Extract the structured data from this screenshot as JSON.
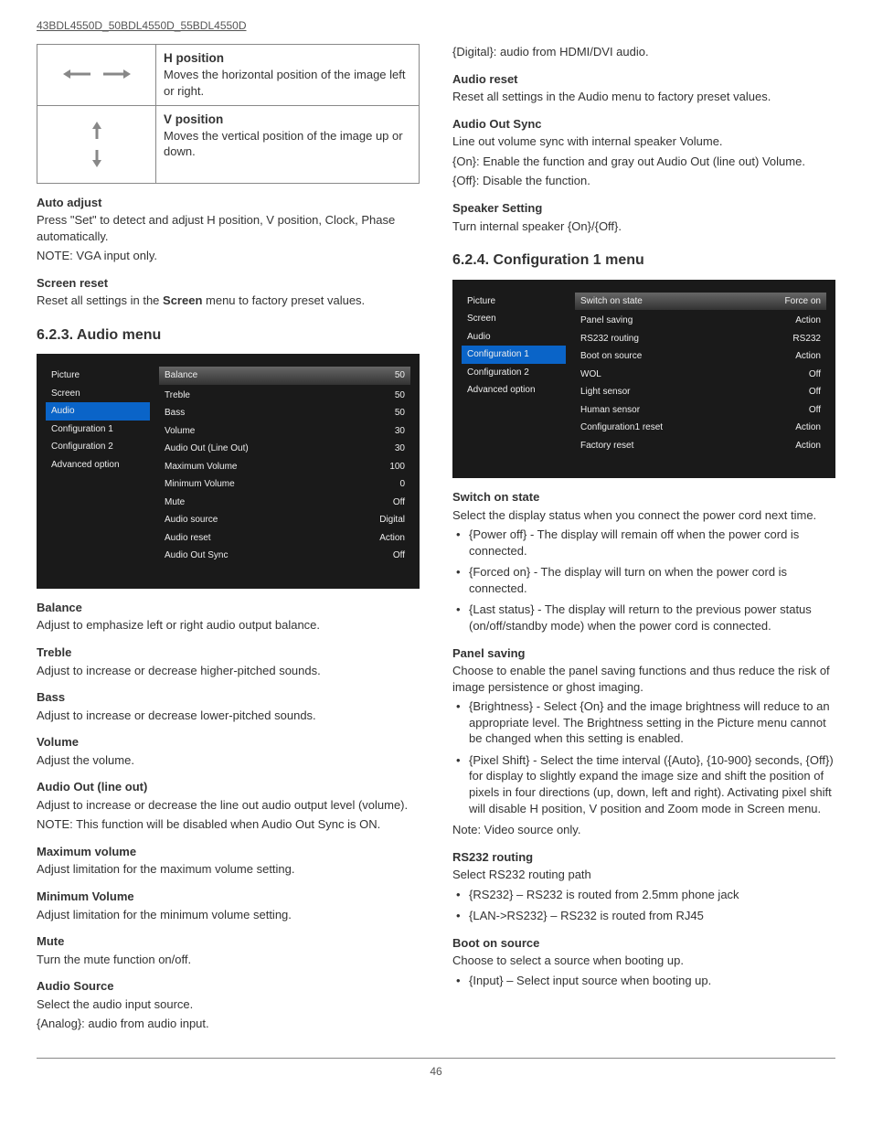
{
  "header": "43BDL4550D_50BDL4550D_55BDL4550D",
  "page_number": "46",
  "left": {
    "table_rows": [
      {
        "title": "H position",
        "desc": "Moves the horizontal position of the image left or right."
      },
      {
        "title": "V position",
        "desc": "Moves the vertical position of the image up or down."
      }
    ],
    "auto_adjust": {
      "h": "Auto adjust",
      "p1": "Press \"Set\" to detect and adjust H position, V position, Clock, Phase automatically.",
      "p2": "NOTE: VGA input only."
    },
    "screen_reset": {
      "h": "Screen reset",
      "p": "Reset all settings in the Screen menu to factory preset values."
    },
    "section_title": "6.2.3.  Audio menu",
    "osd": {
      "nav": [
        "Picture",
        "Screen",
        "Audio",
        "Configuration 1",
        "Configuration 2",
        "Advanced option"
      ],
      "nav_selected_index": 2,
      "rows": [
        {
          "k": "Balance",
          "v": "50",
          "header": true
        },
        {
          "k": "Treble",
          "v": "50"
        },
        {
          "k": "Bass",
          "v": "50"
        },
        {
          "k": "Volume",
          "v": "30"
        },
        {
          "k": "Audio Out (Line Out)",
          "v": "30"
        },
        {
          "k": "Maximum Volume",
          "v": "100"
        },
        {
          "k": "Minimum Volume",
          "v": "0"
        },
        {
          "k": "Mute",
          "v": "Off"
        },
        {
          "k": "Audio source",
          "v": "Digital"
        },
        {
          "k": "Audio reset",
          "v": "Action"
        },
        {
          "k": "Audio Out Sync",
          "v": "Off"
        }
      ]
    },
    "defs": [
      {
        "h": "Balance",
        "p": "Adjust to emphasize left or right audio output balance."
      },
      {
        "h": "Treble",
        "p": "Adjust to increase or decrease higher-pitched sounds."
      },
      {
        "h": "Bass",
        "p": "Adjust to increase or decrease lower-pitched sounds."
      },
      {
        "h": "Volume",
        "p": "Adjust the volume."
      },
      {
        "h": "Audio Out (line out)",
        "p": "Adjust to increase or decrease the line out audio output level (volume).",
        "p2": "NOTE: This function will be disabled when Audio Out Sync is ON."
      },
      {
        "h": "Maximum volume",
        "p": "Adjust limitation for the maximum volume setting."
      },
      {
        "h": "Minimum Volume",
        "p": "Adjust limitation for the minimum volume setting."
      },
      {
        "h": "Mute",
        "p": "Turn the mute function on/off."
      },
      {
        "h": "Audio Source",
        "p": "Select the audio input source.",
        "p2": "{Analog}: audio from audio input."
      }
    ]
  },
  "right": {
    "pretext": "{Digital}: audio from HDMI/DVI audio.",
    "defs1": [
      {
        "h": "Audio reset",
        "p": "Reset all settings in the Audio menu to factory preset values."
      },
      {
        "h": "Audio Out Sync",
        "p": "Line out volume sync with internal speaker Volume.",
        "p2": "{On}: Enable the function and gray out Audio Out (line out) Volume.",
        "p3": "{Off}: Disable the function."
      },
      {
        "h": "Speaker Setting",
        "p": "Turn internal speaker {On}/{Off}."
      }
    ],
    "section_title": "6.2.4.  Configuration 1 menu",
    "osd": {
      "nav": [
        "Picture",
        "Screen",
        "Audio",
        "Configuration 1",
        "Configuration 2",
        "Advanced option"
      ],
      "nav_selected_index": 3,
      "rows": [
        {
          "k": "Switch on state",
          "v": "Force on",
          "header": true
        },
        {
          "k": "Panel saving",
          "v": "Action"
        },
        {
          "k": "RS232 routing",
          "v": "RS232"
        },
        {
          "k": "Boot on source",
          "v": "Action"
        },
        {
          "k": "WOL",
          "v": "Off"
        },
        {
          "k": "Light sensor",
          "v": "Off"
        },
        {
          "k": "Human sensor",
          "v": "Off"
        },
        {
          "k": "Configuration1 reset",
          "v": "Action"
        },
        {
          "k": "Factory reset",
          "v": "Action"
        }
      ]
    },
    "switch_on": {
      "h": "Switch on state",
      "p": "Select the display status when you connect the power cord next time.",
      "items": [
        "{Power off} - The display will remain off when the power cord is connected.",
        "{Forced on} - The display will turn on when the power cord is connected.",
        "{Last status} - The display will return to the previous power status (on/off/standby mode) when the power cord is connected."
      ]
    },
    "panel_saving": {
      "h": "Panel saving",
      "p": "Choose to enable the panel saving functions and thus reduce the risk of image persistence or ghost imaging.",
      "items": [
        "{Brightness} - Select {On} and the image brightness will reduce to an appropriate level. The Brightness setting in the Picture menu cannot be changed when this setting is enabled.",
        "{Pixel Shift} - Select the time interval ({Auto}, {10-900} seconds, {Off}) for display to slightly expand the image size and shift the position of pixels in four directions (up, down, left and right). Activating pixel shift will disable H position, V position and Zoom mode in Screen menu."
      ],
      "note": "Note: Video source only."
    },
    "rs232": {
      "h": "RS232 routing",
      "p": "Select RS232 routing path",
      "items": [
        "{RS232} – RS232 is routed from 2.5mm phone jack",
        "{LAN->RS232} – RS232 is routed from RJ45"
      ]
    },
    "boot": {
      "h": "Boot on source",
      "p": "Choose to select a source when booting up.",
      "items": [
        "{Input} – Select input source when booting up."
      ]
    }
  }
}
